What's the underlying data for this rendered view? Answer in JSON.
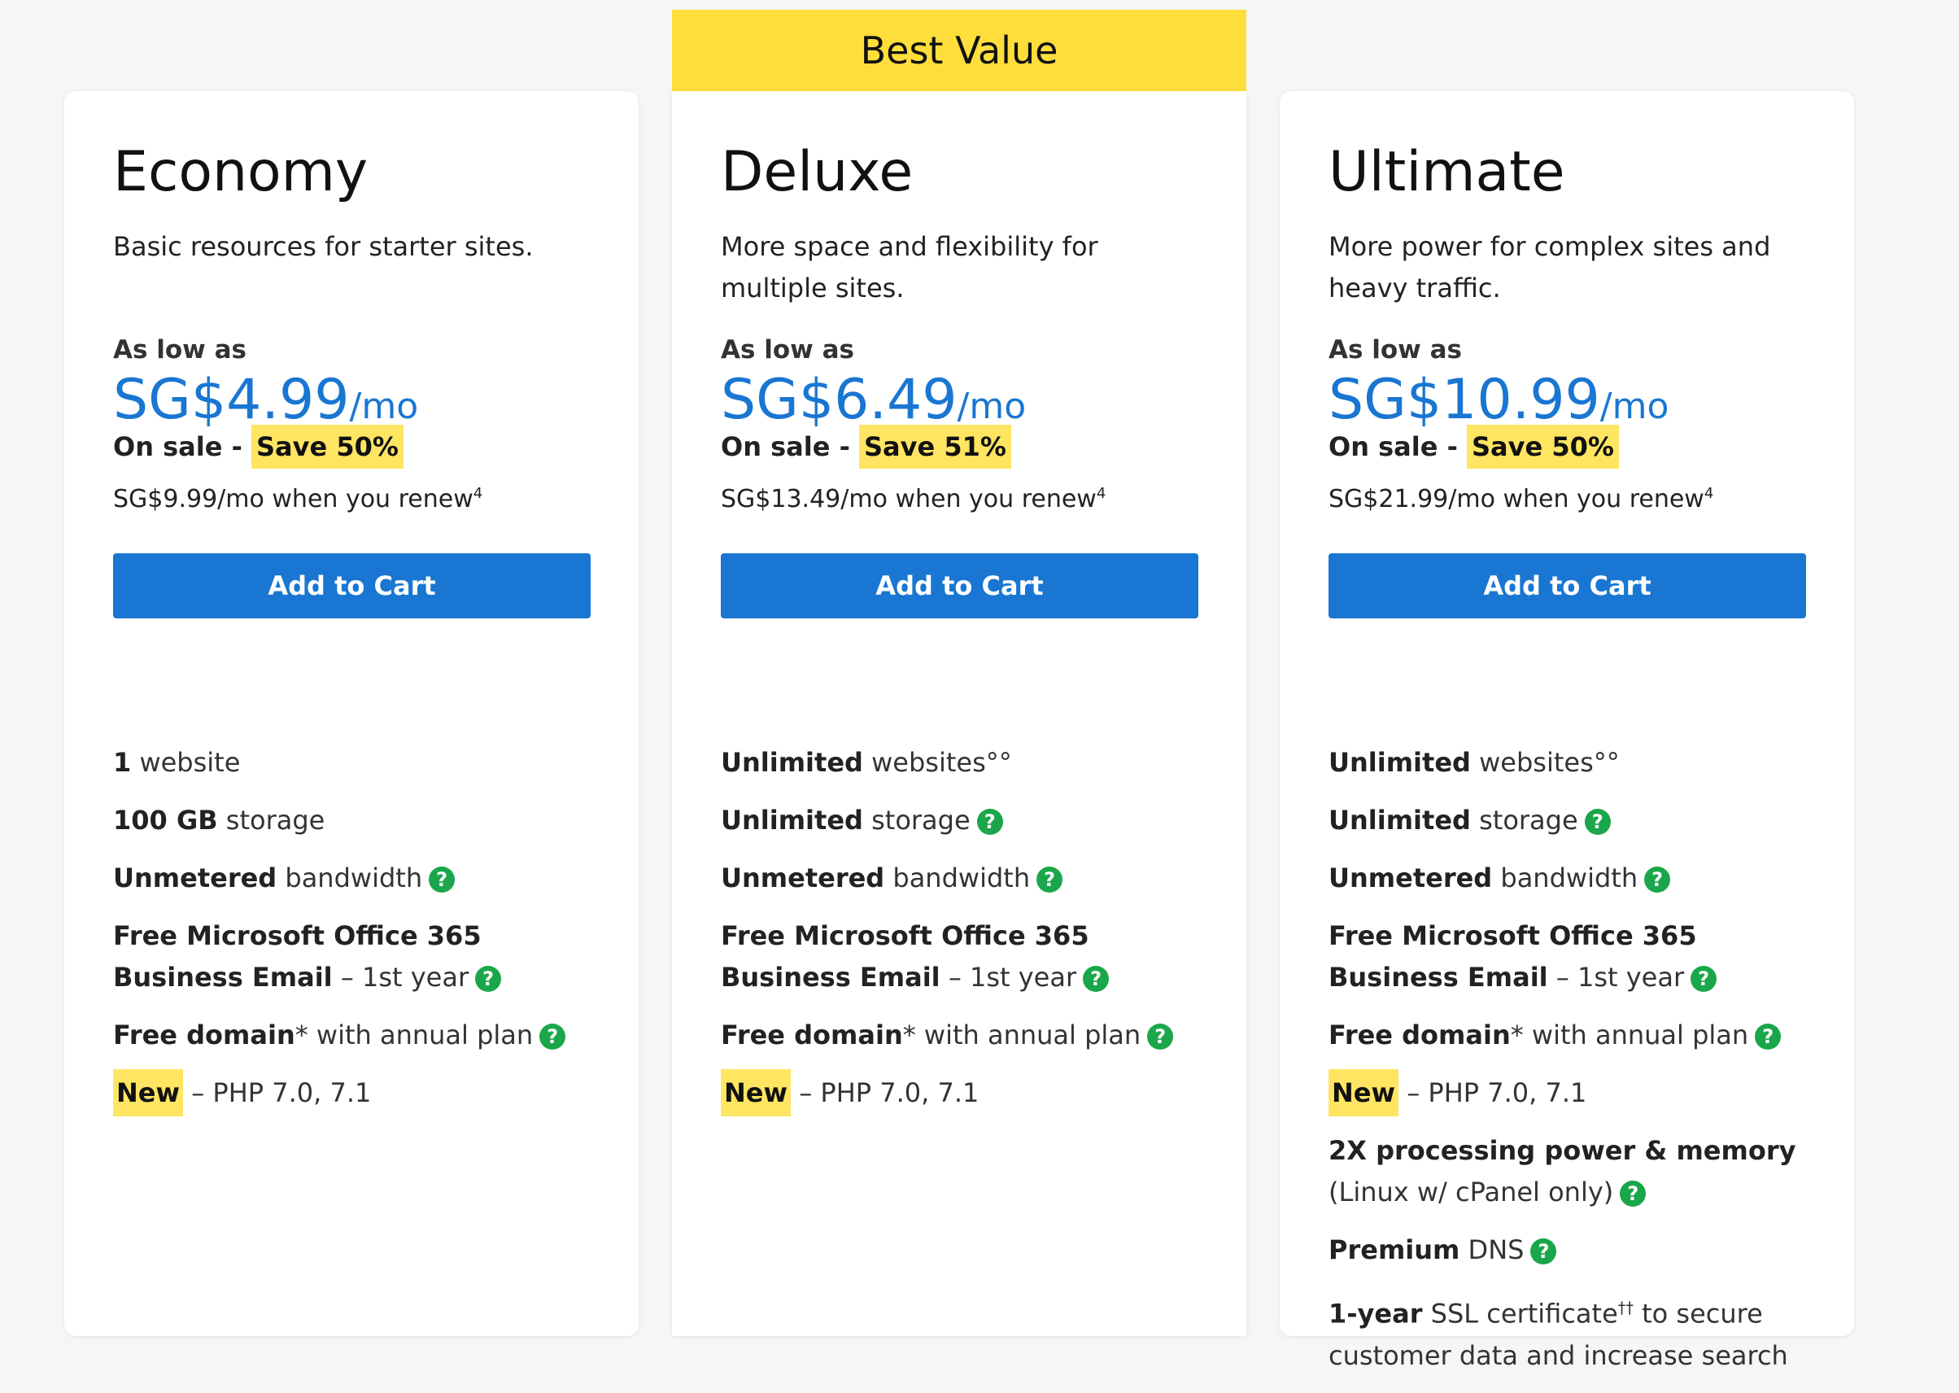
{
  "banner": {
    "label": "Best Value"
  },
  "colors": {
    "accent": "#1976d2",
    "highlight": "#ffe562",
    "banner": "#ffde3b",
    "help_icon": "#1aa64a"
  },
  "help_icon": "?",
  "plans": [
    {
      "name": "Economy",
      "description": "Basic resources for starter sites.",
      "as_low_as": "As low as",
      "price": "SG$4.99",
      "per": "/mo",
      "on_sale": "On sale -",
      "save": "Save 50%",
      "renew": "SG$9.99/mo when you renew",
      "renew_note": "4",
      "cta": "Add to Cart",
      "features": [
        {
          "bold": "1",
          "text": " website"
        },
        {
          "bold": "100 GB",
          "text": " storage"
        },
        {
          "bold": "Unmetered",
          "text": " bandwidth"
        },
        {
          "bold": "Free Microsoft Office 365 Business Email",
          "text": " – 1st year"
        },
        {
          "bold": "Free domain",
          "text": "* with annual plan"
        },
        {
          "tag": "New",
          "text": " – PHP 7.0, 7.1"
        }
      ]
    },
    {
      "name": "Deluxe",
      "description": "More space and flexibility for multiple sites.",
      "as_low_as": "As low as",
      "price": "SG$6.49",
      "per": "/mo",
      "on_sale": "On sale -",
      "save": "Save 51%",
      "renew": "SG$13.49/mo when you renew",
      "renew_note": "4",
      "cta": "Add to Cart",
      "features": [
        {
          "bold": "Unlimited",
          "text": " websites°°"
        },
        {
          "bold": "Unlimited",
          "text": " storage"
        },
        {
          "bold": "Unmetered",
          "text": " bandwidth"
        },
        {
          "bold": "Free Microsoft Office 365 Business Email",
          "text": " – 1st year"
        },
        {
          "bold": "Free domain",
          "text": "* with annual plan"
        },
        {
          "tag": "New",
          "text": " – PHP 7.0, 7.1"
        }
      ]
    },
    {
      "name": "Ultimate",
      "description": "More power for complex sites and heavy traffic.",
      "as_low_as": "As low as",
      "price": "SG$10.99",
      "per": "/mo",
      "on_sale": "On sale -",
      "save": "Save 50%",
      "renew": "SG$21.99/mo when you renew",
      "renew_note": "4",
      "cta": "Add to Cart",
      "features": [
        {
          "bold": "Unlimited",
          "text": " websites°°"
        },
        {
          "bold": "Unlimited",
          "text": " storage"
        },
        {
          "bold": "Unmetered",
          "text": " bandwidth"
        },
        {
          "bold": "Free Microsoft Office 365 Business Email",
          "text": " – 1st year"
        },
        {
          "bold": "Free domain",
          "text": "* with annual plan"
        },
        {
          "tag": "New",
          "text": " – PHP 7.0, 7.1"
        },
        {
          "bold": "2X processing power & memory",
          "text": " (Linux w/ cPanel only)"
        },
        {
          "bold": "Premium",
          "text": " DNS"
        },
        {
          "bold": "1-year",
          "text": " SSL certificate",
          "sup": "††",
          "text2": " to secure customer data and increase search"
        }
      ]
    }
  ]
}
